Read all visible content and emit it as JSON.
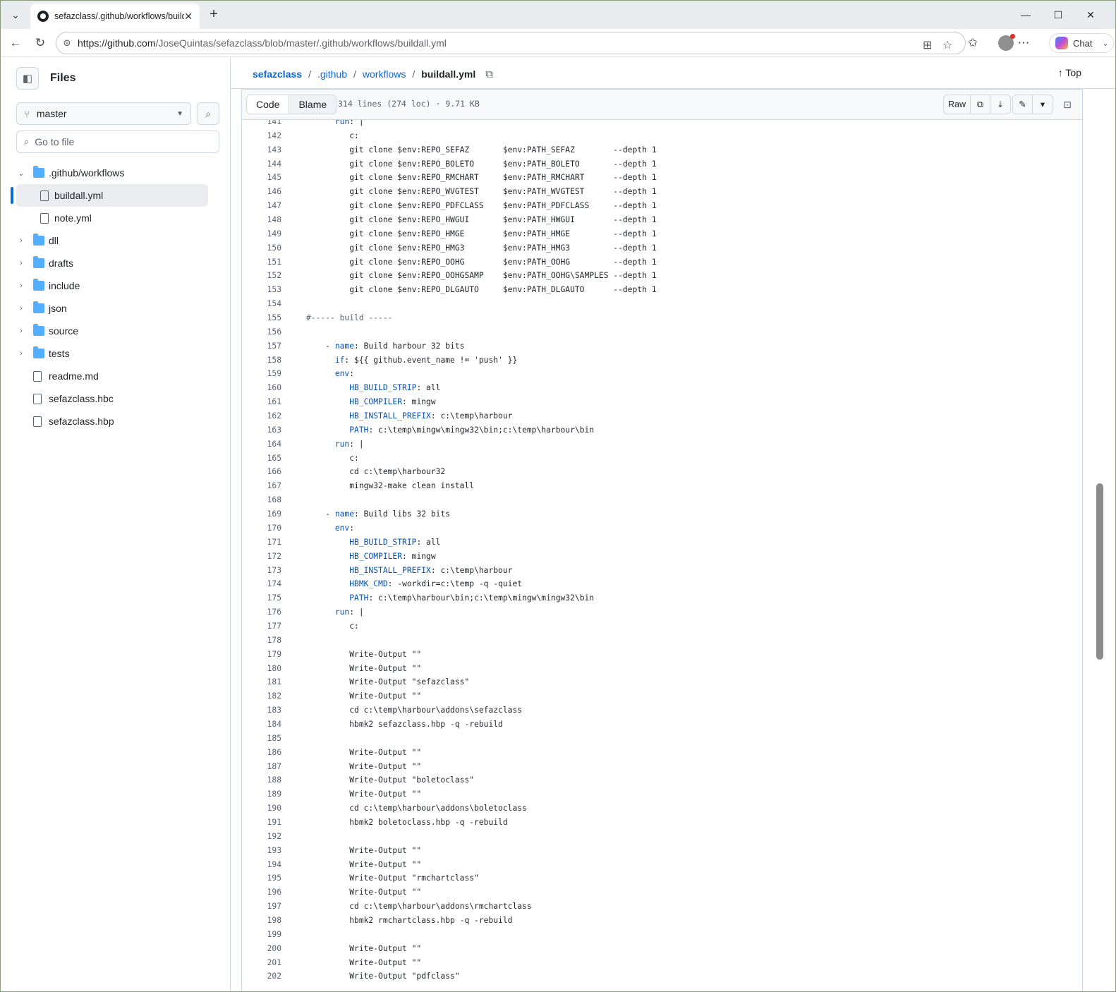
{
  "browser": {
    "tab_title": "sefazclass/.github/workflows/build",
    "url_host": "https://github.com",
    "url_path": "/JoseQuintas/sefazclass/blob/master/.github/workflows/buildall.yml",
    "chat_label": "Chat"
  },
  "sidebar": {
    "title": "Files",
    "branch": "master",
    "goto_placeholder": "Go to file",
    "tree": [
      {
        "label": ".github/workflows",
        "type": "folder",
        "expanded": true
      },
      {
        "label": "buildall.yml",
        "type": "file",
        "selected": true
      },
      {
        "label": "note.yml",
        "type": "file"
      },
      {
        "label": "dll",
        "type": "folder"
      },
      {
        "label": "drafts",
        "type": "folder"
      },
      {
        "label": "include",
        "type": "folder"
      },
      {
        "label": "json",
        "type": "folder"
      },
      {
        "label": "source",
        "type": "folder"
      },
      {
        "label": "tests",
        "type": "folder"
      },
      {
        "label": "readme.md",
        "type": "file"
      },
      {
        "label": "sefazclass.hbc",
        "type": "file"
      },
      {
        "label": "sefazclass.hbp",
        "type": "file"
      }
    ]
  },
  "breadcrumb": {
    "repo": "sefazclass",
    "dir1": ".github",
    "dir2": "workflows",
    "file": "buildall.yml",
    "top_label": "Top"
  },
  "filebar": {
    "code_tab": "Code",
    "blame_tab": "Blame",
    "meta": "314 lines (274 loc) · 9.71 KB",
    "raw_label": "Raw"
  },
  "code_lines": [
    {
      "n": "141",
      "t": "      <k>run</k>: |"
    },
    {
      "n": "142",
      "t": "         c:"
    },
    {
      "n": "143",
      "t": "         git clone $env:REPO_SEFAZ       $env:PATH_SEFAZ        --depth 1"
    },
    {
      "n": "144",
      "t": "         git clone $env:REPO_BOLETO      $env:PATH_BOLETO       --depth 1"
    },
    {
      "n": "145",
      "t": "         git clone $env:REPO_RMCHART     $env:PATH_RMCHART      --depth 1"
    },
    {
      "n": "146",
      "t": "         git clone $env:REPO_WVGTEST     $env:PATH_WVGTEST      --depth 1"
    },
    {
      "n": "147",
      "t": "         git clone $env:REPO_PDFCLASS    $env:PATH_PDFCLASS     --depth 1"
    },
    {
      "n": "148",
      "t": "         git clone $env:REPO_HWGUI       $env:PATH_HWGUI        --depth 1"
    },
    {
      "n": "149",
      "t": "         git clone $env:REPO_HMGE        $env:PATH_HMGE         --depth 1"
    },
    {
      "n": "150",
      "t": "         git clone $env:REPO_HMG3        $env:PATH_HMG3         --depth 1"
    },
    {
      "n": "151",
      "t": "         git clone $env:REPO_OOHG        $env:PATH_OOHG         --depth 1"
    },
    {
      "n": "152",
      "t": "         git clone $env:REPO_OOHGSAMP    $env:PATH_OOHG\\SAMPLES --depth 1"
    },
    {
      "n": "153",
      "t": "         git clone $env:REPO_DLGAUTO     $env:PATH_DLGAUTO      --depth 1"
    },
    {
      "n": "154",
      "t": ""
    },
    {
      "n": "155",
      "t": "<c>#----- build -----</c>"
    },
    {
      "n": "156",
      "t": ""
    },
    {
      "n": "157",
      "t": "    - <k>name</k>: Build harbour 32 bits"
    },
    {
      "n": "158",
      "t": "      <k>if</k>: ${{ github.event_name != 'push' }}"
    },
    {
      "n": "159",
      "t": "      <k>env</k>:"
    },
    {
      "n": "160",
      "t": "         <k>HB_BUILD_STRIP</k>: all"
    },
    {
      "n": "161",
      "t": "         <k>HB_COMPILER</k>: mingw"
    },
    {
      "n": "162",
      "t": "         <k>HB_INSTALL_PREFIX</k>: c:\\temp\\harbour"
    },
    {
      "n": "163",
      "t": "         <k>PATH</k>: c:\\temp\\mingw\\mingw32\\bin;c:\\temp\\harbour\\bin"
    },
    {
      "n": "164",
      "t": "      <k>run</k>: |"
    },
    {
      "n": "165",
      "t": "         c:"
    },
    {
      "n": "166",
      "t": "         cd c:\\temp\\harbour32"
    },
    {
      "n": "167",
      "t": "         mingw32-make clean install"
    },
    {
      "n": "168",
      "t": ""
    },
    {
      "n": "169",
      "t": "    - <k>name</k>: Build libs 32 bits"
    },
    {
      "n": "170",
      "t": "      <k>env</k>:"
    },
    {
      "n": "171",
      "t": "         <k>HB_BUILD_STRIP</k>: all"
    },
    {
      "n": "172",
      "t": "         <k>HB_COMPILER</k>: mingw"
    },
    {
      "n": "173",
      "t": "         <k>HB_INSTALL_PREFIX</k>: c:\\temp\\harbour"
    },
    {
      "n": "174",
      "t": "         <k>HBMK_CMD</k>: -workdir=c:\\temp -q -quiet"
    },
    {
      "n": "175",
      "t": "         <k>PATH</k>: c:\\temp\\harbour\\bin;c:\\temp\\mingw\\mingw32\\bin"
    },
    {
      "n": "176",
      "t": "      <k>run</k>: |"
    },
    {
      "n": "177",
      "t": "         c:"
    },
    {
      "n": "178",
      "t": ""
    },
    {
      "n": "179",
      "t": "         Write-Output \"\""
    },
    {
      "n": "180",
      "t": "         Write-Output \"\""
    },
    {
      "n": "181",
      "t": "         Write-Output \"sefazclass\""
    },
    {
      "n": "182",
      "t": "         Write-Output \"\""
    },
    {
      "n": "183",
      "t": "         cd c:\\temp\\harbour\\addons\\sefazclass"
    },
    {
      "n": "184",
      "t": "         hbmk2 sefazclass.hbp -q -rebuild"
    },
    {
      "n": "185",
      "t": ""
    },
    {
      "n": "186",
      "t": "         Write-Output \"\""
    },
    {
      "n": "187",
      "t": "         Write-Output \"\""
    },
    {
      "n": "188",
      "t": "         Write-Output \"boletoclass\""
    },
    {
      "n": "189",
      "t": "         Write-Output \"\""
    },
    {
      "n": "190",
      "t": "         cd c:\\temp\\harbour\\addons\\boletoclass"
    },
    {
      "n": "191",
      "t": "         hbmk2 boletoclass.hbp -q -rebuild"
    },
    {
      "n": "192",
      "t": ""
    },
    {
      "n": "193",
      "t": "         Write-Output \"\""
    },
    {
      "n": "194",
      "t": "         Write-Output \"\""
    },
    {
      "n": "195",
      "t": "         Write-Output \"rmchartclass\""
    },
    {
      "n": "196",
      "t": "         Write-Output \"\""
    },
    {
      "n": "197",
      "t": "         cd c:\\temp\\harbour\\addons\\rmchartclass"
    },
    {
      "n": "198",
      "t": "         hbmk2 rmchartclass.hbp -q -rebuild"
    },
    {
      "n": "199",
      "t": ""
    },
    {
      "n": "200",
      "t": "         Write-Output \"\""
    },
    {
      "n": "201",
      "t": "         Write-Output \"\""
    },
    {
      "n": "202",
      "t": "         Write-Output \"pdfclass\""
    }
  ]
}
